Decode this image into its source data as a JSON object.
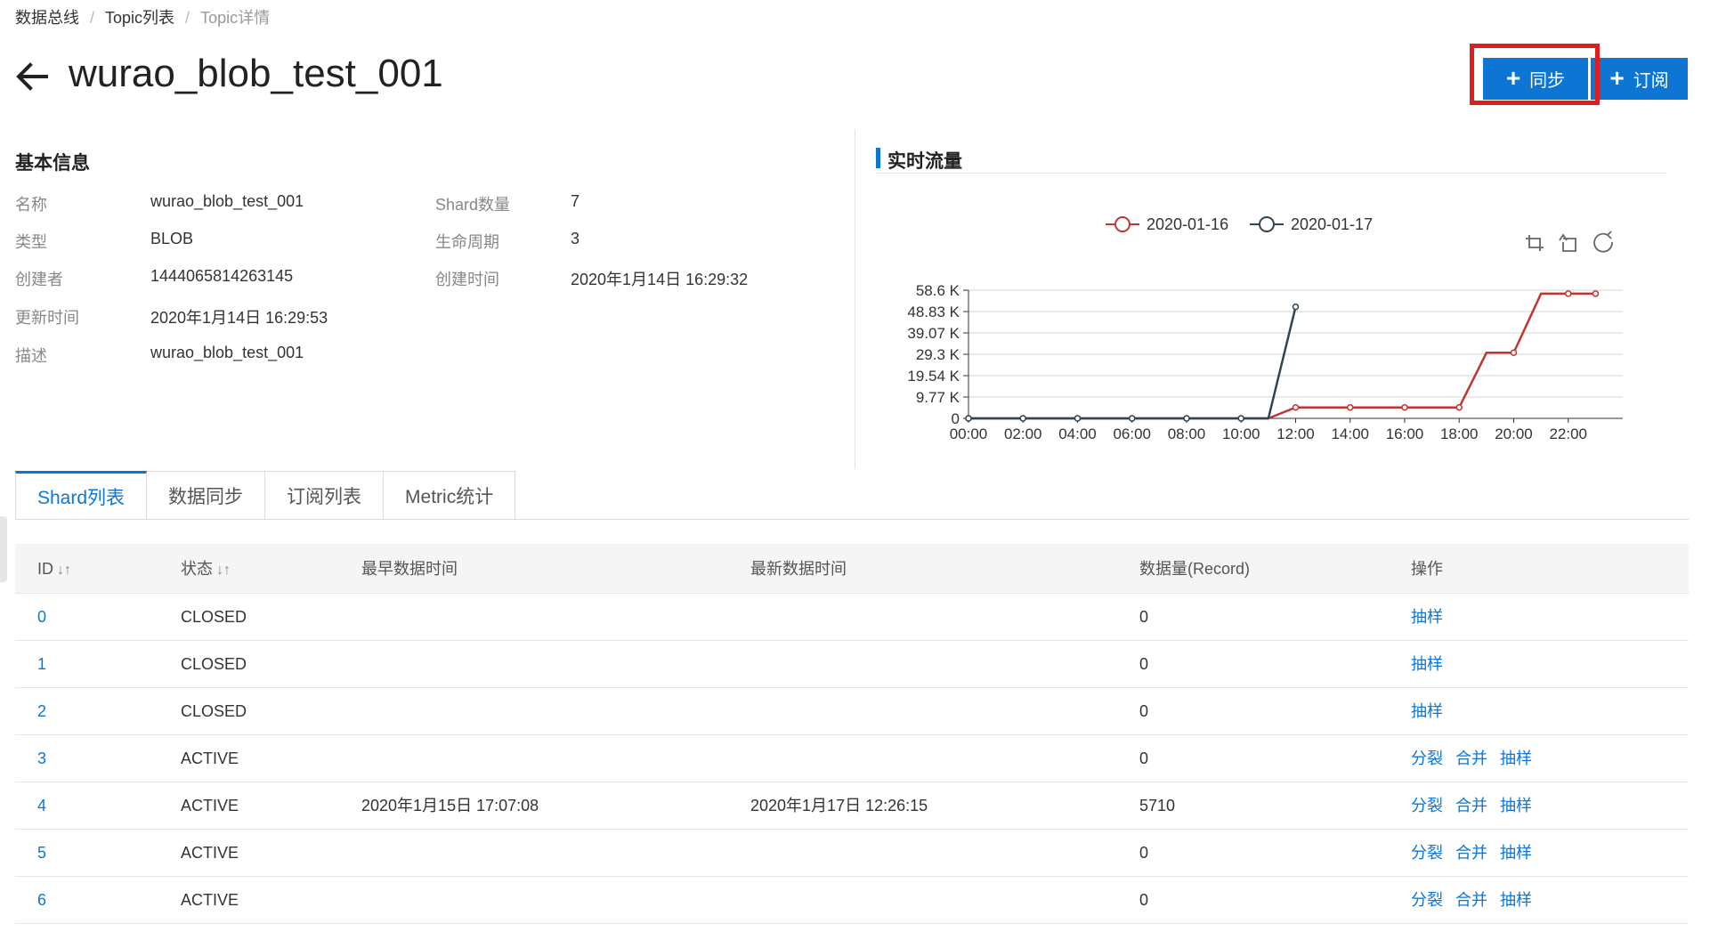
{
  "breadcrumb": [
    "数据总线",
    "Topic列表",
    "Topic详情"
  ],
  "breadcrumb_sep": "/",
  "title": "wurao_blob_test_001",
  "buttons": {
    "sync": "同步",
    "subscribe": "订阅",
    "plus": "+"
  },
  "icons": {
    "back": "arrow-left-icon",
    "plus": "plus-icon",
    "sort": "sort-icon",
    "zoom": "zoom-select-icon",
    "restore": "zoom-reset-icon",
    "refresh": "refresh-icon"
  },
  "colors": {
    "primary": "#0d76d4",
    "highlight": "#e21d1d",
    "series1": "#c23531",
    "series2": "#2f4554"
  },
  "basic_info": {
    "title": "基本信息",
    "left": [
      {
        "label": "名称",
        "value": "wurao_blob_test_001"
      },
      {
        "label": "类型",
        "value": "BLOB"
      },
      {
        "label": "创建者",
        "value": "1444065814263145"
      },
      {
        "label": "更新时间",
        "value": "2020年1月14日 16:29:53"
      },
      {
        "label": "描述",
        "value": "wurao_blob_test_001"
      }
    ],
    "right": [
      {
        "label": "Shard数量",
        "value": "7"
      },
      {
        "label": "生命周期",
        "value": "3"
      },
      {
        "label": "创建时间",
        "value": "2020年1月14日 16:29:32"
      }
    ]
  },
  "realtime": {
    "title": "实时流量"
  },
  "chart_data": {
    "type": "line",
    "categories": [
      "00:00",
      "01:00",
      "02:00",
      "03:00",
      "04:00",
      "05:00",
      "06:00",
      "07:00",
      "08:00",
      "09:00",
      "10:00",
      "11:00",
      "12:00",
      "13:00",
      "14:00",
      "15:00",
      "16:00",
      "17:00",
      "18:00",
      "19:00",
      "20:00",
      "21:00",
      "22:00",
      "23:00"
    ],
    "x_tick_labels": [
      "00:00",
      "02:00",
      "04:00",
      "06:00",
      "08:00",
      "10:00",
      "12:00",
      "14:00",
      "16:00",
      "18:00",
      "20:00",
      "22:00"
    ],
    "y_tick_labels": [
      "0",
      "9.77 K",
      "19.54 K",
      "29.3 K",
      "39.07 K",
      "48.83 K",
      "58.6 K"
    ],
    "ylim": [
      0,
      58600
    ],
    "legend_position": "top-center",
    "grid": true,
    "series": [
      {
        "name": "2020-01-16",
        "values": [
          0,
          0,
          0,
          0,
          0,
          0,
          0,
          0,
          0,
          0,
          0,
          0,
          5000,
          5000,
          5000,
          5000,
          5000,
          5000,
          5000,
          30000,
          30000,
          57000,
          57000,
          57000
        ]
      },
      {
        "name": "2020-01-17",
        "values": [
          0,
          0,
          0,
          0,
          0,
          0,
          0,
          0,
          0,
          0,
          0,
          0,
          51000
        ]
      }
    ]
  },
  "tabs": [
    "Shard列表",
    "数据同步",
    "订阅列表",
    "Metric统计"
  ],
  "table": {
    "headers": [
      "ID",
      "状态",
      "最早数据时间",
      "最新数据时间",
      "数据量(Record)",
      "操作"
    ],
    "sort_symbol": "↓↑",
    "rows": [
      {
        "id": "0",
        "status": "CLOSED",
        "earliest": "",
        "latest": "",
        "records": "0",
        "ops": [
          "抽样"
        ]
      },
      {
        "id": "1",
        "status": "CLOSED",
        "earliest": "",
        "latest": "",
        "records": "0",
        "ops": [
          "抽样"
        ]
      },
      {
        "id": "2",
        "status": "CLOSED",
        "earliest": "",
        "latest": "",
        "records": "0",
        "ops": [
          "抽样"
        ]
      },
      {
        "id": "3",
        "status": "ACTIVE",
        "earliest": "",
        "latest": "",
        "records": "0",
        "ops": [
          "分裂",
          "合并",
          "抽样"
        ]
      },
      {
        "id": "4",
        "status": "ACTIVE",
        "earliest": "2020年1月15日 17:07:08",
        "latest": "2020年1月17日 12:26:15",
        "records": "5710",
        "ops": [
          "分裂",
          "合并",
          "抽样"
        ]
      },
      {
        "id": "5",
        "status": "ACTIVE",
        "earliest": "",
        "latest": "",
        "records": "0",
        "ops": [
          "分裂",
          "合并",
          "抽样"
        ]
      },
      {
        "id": "6",
        "status": "ACTIVE",
        "earliest": "",
        "latest": "",
        "records": "0",
        "ops": [
          "分裂",
          "合并",
          "抽样"
        ]
      }
    ]
  }
}
